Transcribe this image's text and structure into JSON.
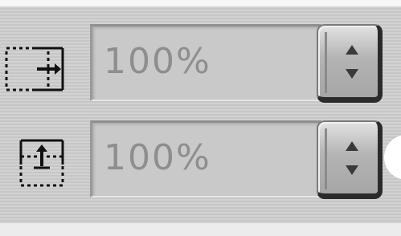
{
  "scale": {
    "horizontal": {
      "value": "100%",
      "icon": "horizontal-scale-icon"
    },
    "vertical": {
      "value": "100%",
      "icon": "vertical-scale-icon"
    }
  }
}
